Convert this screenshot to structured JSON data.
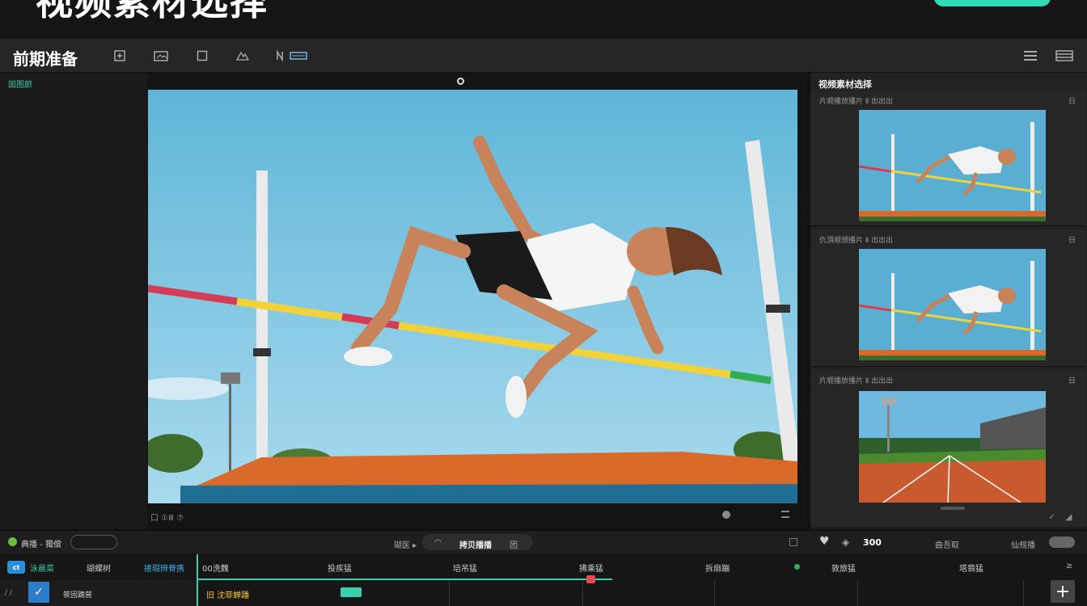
{
  "banner": {
    "title": "视频素材选择"
  },
  "toolbar": {
    "title": "前期准备"
  },
  "left_panel": {
    "label": "固图颜"
  },
  "viewer": {
    "caption": "口 ①Ⅲ ⑦"
  },
  "right_panel": {
    "title": "视频素材选择",
    "clips": [
      {
        "meta": "片顺播放播片 Ⅱ  出出出",
        "corner": "日",
        "thumb": "high-jump-1"
      },
      {
        "meta": "仇頂顺颁播片 Ⅱ 出出出",
        "corner": "日",
        "thumb": "high-jump-2"
      },
      {
        "meta": "片顺播放播片 Ⅱ 出出出",
        "corner": "日",
        "thumb": "track"
      }
    ]
  },
  "transport": {
    "left_label": "典播 - 獨偿",
    "mid_label": "瑚医 ▸",
    "pill_label": "拷贝播播",
    "pill_end": "团",
    "count": "300",
    "right1": "曲吾取",
    "right2": "仙规播"
  },
  "timeline": {
    "logo": "ct",
    "heads": [
      {
        "text": "泳晨菜",
        "color": "#3cc9a3"
      },
      {
        "text": "瑚蝶树",
        "color": "#cccccc"
      },
      {
        "text": "搓瑕辨脊携",
        "color": "#3fb0e8"
      },
      {
        "text": "00洗魏",
        "color": "#cccccc"
      },
      {
        "text": "投疾猛",
        "color": "#cccccc"
      },
      {
        "text": "培吊猛",
        "color": "#cccccc"
      },
      {
        "text": "拂乘猛",
        "color": "#cccccc"
      },
      {
        "text": "拆扇蹦",
        "color": "#cccccc"
      },
      {
        "text": "敦旅猛",
        "color": "#cccccc"
      },
      {
        "text": "塔翡猛",
        "color": "#cccccc"
      }
    ],
    "track_name": "筱固蹢蒈",
    "slash": "/ /",
    "clip_label": "旧 沈菲蝉蹯",
    "arrow": "≥"
  }
}
